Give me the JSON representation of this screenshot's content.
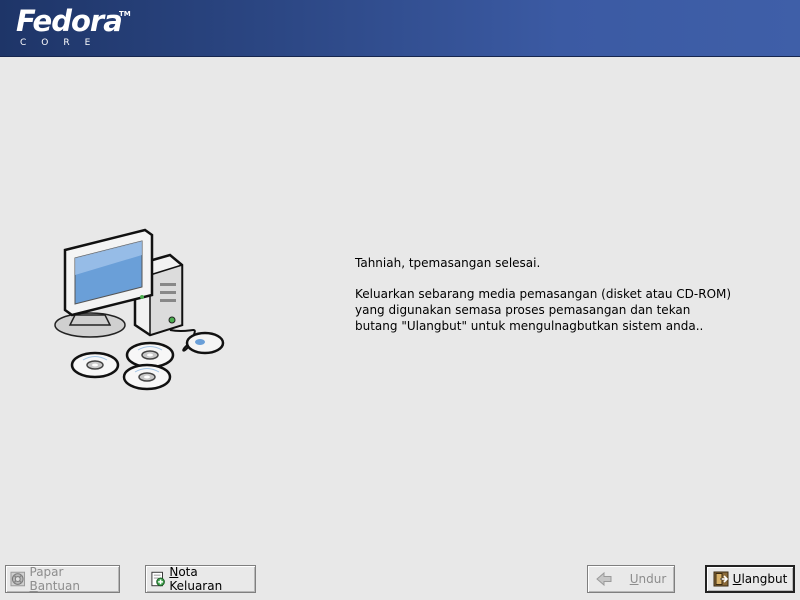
{
  "header": {
    "brand_name": "Fedora",
    "brand_tm": "TM",
    "brand_sub": "CORE"
  },
  "message": {
    "congrats": "Tahniah, tpemasangan selesai.",
    "instructions": "Keluarkan sebarang media pemasangan (disket atau CD-ROM)\nyang digunakan semasa proses pemasangan dan tekan\nbutang  \"Ulangbut\" untuk mengulnagbutkan sistem anda.."
  },
  "buttons": {
    "help": {
      "pre": "Papar ",
      "mnemonic": "B",
      "post": "antuan",
      "icon": "lifebuoy-icon",
      "enabled": false
    },
    "notes": {
      "pre": "",
      "mnemonic": "N",
      "post": "ota Keluaran",
      "icon": "add-note-icon",
      "enabled": true
    },
    "back": {
      "pre": "",
      "mnemonic": "U",
      "post": "ndur",
      "icon": "back-arrow-icon",
      "enabled": false
    },
    "reboot": {
      "pre": "",
      "mnemonic": "U",
      "post": "langbut",
      "icon": "exit-icon",
      "enabled": true
    }
  },
  "illustration": {
    "icon": "computer-with-discs-icon"
  }
}
